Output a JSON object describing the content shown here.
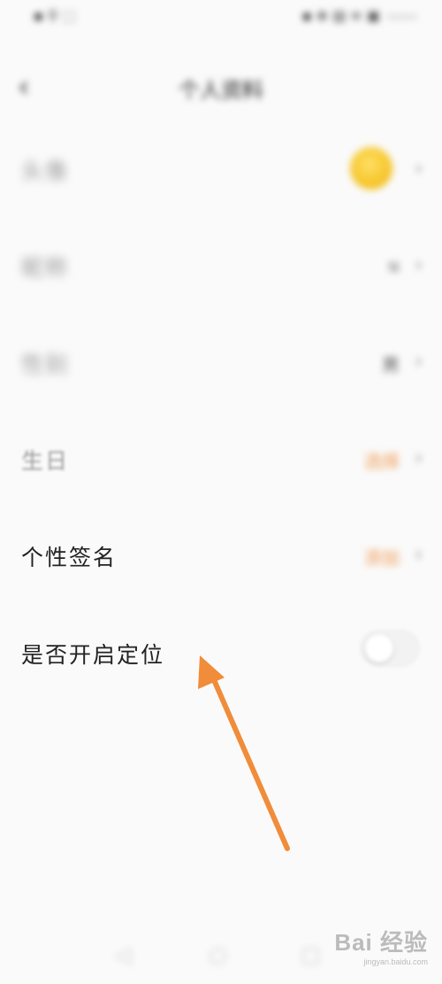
{
  "status_bar": {
    "left": "▪ ⚲ ⬚",
    "right": "▪ ⊕ ▤ ≡ ▣",
    "battery": "▭▭▭"
  },
  "header": {
    "back": "‹",
    "title": "个人资料"
  },
  "rows": [
    {
      "label": "头像",
      "value": "",
      "has_avatar": true
    },
    {
      "label": "昵称",
      "value": "u"
    },
    {
      "label": "性别",
      "value": "男"
    },
    {
      "label": "生日",
      "value": "选择"
    },
    {
      "label": "个性签名",
      "value": "添加"
    },
    {
      "label": "是否开启定位",
      "toggle_on": false
    }
  ],
  "chevron": "›",
  "nav": {
    "back": "◁",
    "home": "○",
    "recent": "▢"
  },
  "watermark": {
    "main": "Bai 经验",
    "sub": "jingyan.baidu.com"
  },
  "colors": {
    "accent_orange": "#f09a52",
    "arrow": "#f08c3a",
    "avatar_yellow": "#f4c020"
  }
}
